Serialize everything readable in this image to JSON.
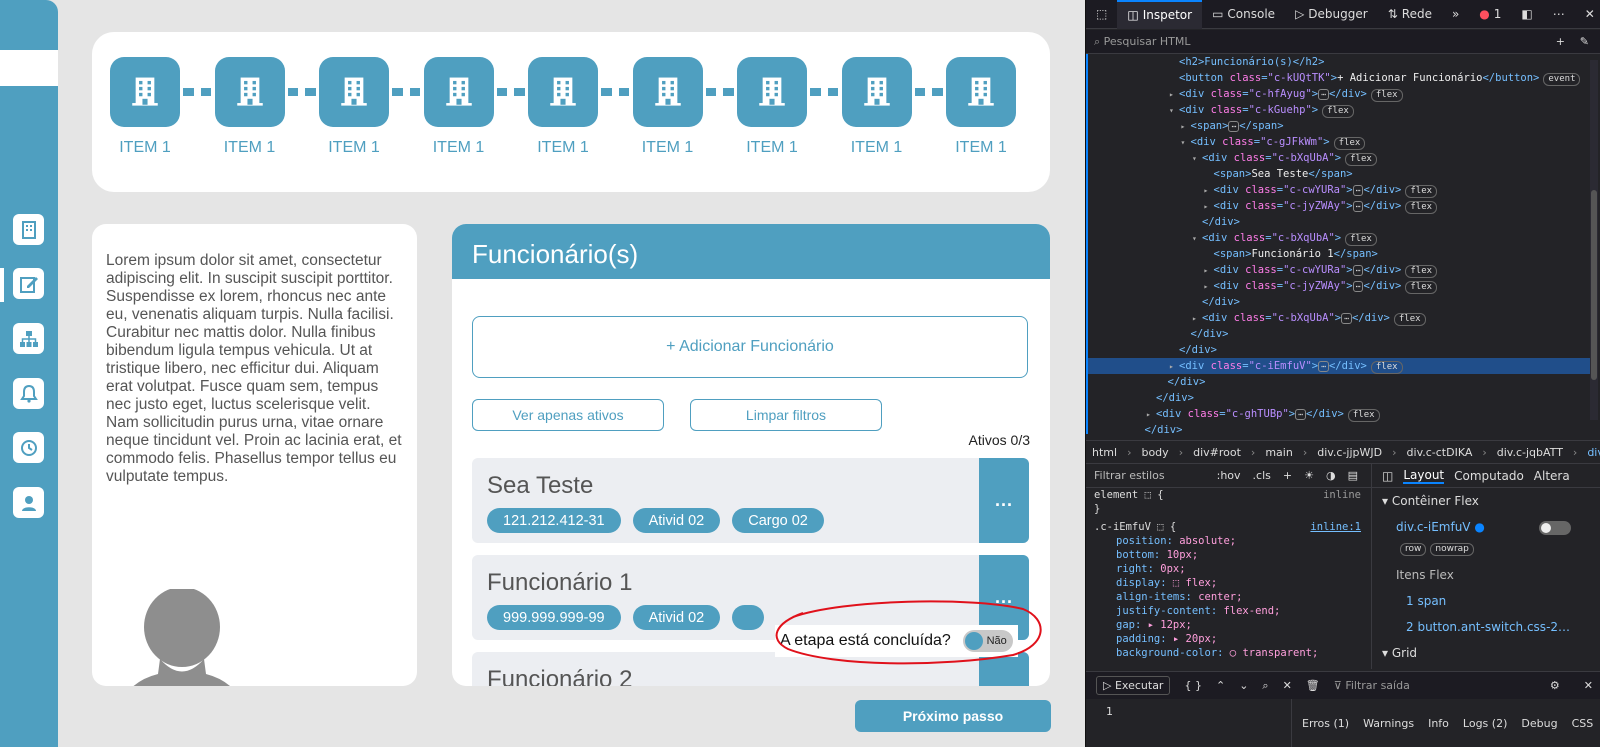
{
  "app": {
    "step_label": "ITEM 1",
    "steps_count_label": [
      "ITEM 1",
      "ITEM 1",
      "ITEM 1",
      "ITEM 1",
      "ITEM 1",
      "ITEM 1",
      "ITEM 1",
      "ITEM 1",
      "ITEM 1"
    ],
    "lorem": "Lorem ipsum dolor sit amet, consectetur adipiscing elit. In suscipit suscipit porttitor. Suspendisse ex lorem, rhoncus nec ante eu, venenatis aliquam turpis. Nulla facilisi. Curabitur nec mattis dolor. Nulla finibus bibendum ligula tempus vehicula. Ut at tristique libero, nec efficitur dui. Aliquam erat volutpat. Fusce quam sem, tempus nec justo eget, luctus scelerisque velit. Nam sollicitudin purus urna, vitae ornare neque tincidunt vel. Proin ac lacinia erat, et commodo felis. Phasellus tempor tellus eu vulputate tempus.",
    "employees": {
      "title": "Funcionário(s)",
      "add_button": "+ Adicionar Funcionário",
      "filter_active": "Ver apenas ativos",
      "filter_clear": "Limpar filtros",
      "active_count": "Ativos 0/3",
      "cards": [
        {
          "name": "Sea Teste",
          "chips": [
            "121.212.412-31",
            "Ativid 02",
            "Cargo 02"
          ]
        },
        {
          "name": "Funcionário 1",
          "chips": [
            "999.999.999-99",
            "Ativid 02",
            ""
          ]
        },
        {
          "name": "Funcionário 2",
          "chips": []
        }
      ],
      "more_label": "..."
    },
    "step_done_question": "A etapa está concluída?",
    "switch_state": "Não",
    "next_button": "Próximo passo"
  },
  "devtools": {
    "tabs": [
      "Inspetor",
      "Console",
      "Debugger",
      "Rede"
    ],
    "error_count": "1",
    "search_placeholder": "Pesquisar HTML",
    "tree": [
      {
        "indent": 6,
        "tri": "",
        "html": "<h2>Funcionário(s)</h2>",
        "type": "raw"
      },
      {
        "indent": 6,
        "tri": "",
        "tag": "button",
        "cls": "c-kUQtTK",
        "text": "+ Adicionar Funcionário",
        "close": "</button>",
        "badge": "event"
      },
      {
        "indent": 6,
        "tri": "▸",
        "tag": "div",
        "cls": "c-hfAyug",
        "text": "",
        "ell": true,
        "close": "</div>",
        "badge": "flex"
      },
      {
        "indent": 6,
        "tri": "▾",
        "tag": "div",
        "cls": "c-kGuehp",
        "text": "",
        "close": "",
        "badge": "flex"
      },
      {
        "indent": 7,
        "tri": "▸",
        "tag": "span",
        "cls": "",
        "ell": true,
        "close": "</span>",
        "badge": ""
      },
      {
        "indent": 7,
        "tri": "▾",
        "tag": "div",
        "cls": "c-gJFkWm",
        "close": "",
        "badge": "flex"
      },
      {
        "indent": 8,
        "tri": "▾",
        "tag": "div",
        "cls": "c-bXqUbA",
        "close": "",
        "badge": "flex"
      },
      {
        "indent": 9,
        "tri": "",
        "tag": "span",
        "cls": "",
        "text": "Sea Teste",
        "close": "</span>",
        "badge": ""
      },
      {
        "indent": 9,
        "tri": "▸",
        "tag": "div",
        "cls": "c-cwYURa",
        "ell": true,
        "close": "</div>",
        "badge": "flex"
      },
      {
        "indent": 9,
        "tri": "▸",
        "tag": "div",
        "cls": "c-jyZWAy",
        "ell": true,
        "close": "</div>",
        "badge": "flex"
      },
      {
        "indent": 8,
        "tri": "",
        "close_only": "</div>"
      },
      {
        "indent": 8,
        "tri": "▾",
        "tag": "div",
        "cls": "c-bXqUbA",
        "close": "",
        "badge": "flex"
      },
      {
        "indent": 9,
        "tri": "",
        "tag": "span",
        "cls": "",
        "text": "Funcionário 1",
        "close": "</span>",
        "badge": ""
      },
      {
        "indent": 9,
        "tri": "▸",
        "tag": "div",
        "cls": "c-cwYURa",
        "ell": true,
        "close": "</div>",
        "badge": "flex"
      },
      {
        "indent": 9,
        "tri": "▸",
        "tag": "div",
        "cls": "c-jyZWAy",
        "ell": true,
        "close": "</div>",
        "badge": "flex"
      },
      {
        "indent": 8,
        "tri": "",
        "close_only": "</div>"
      },
      {
        "indent": 8,
        "tri": "▸",
        "tag": "div",
        "cls": "c-bXqUbA",
        "ell": true,
        "close": "</div>",
        "badge": "flex"
      },
      {
        "indent": 7,
        "tri": "",
        "close_only": "</div>"
      },
      {
        "indent": 6,
        "tri": "",
        "close_only": "</div>"
      },
      {
        "indent": 6,
        "tri": "▸",
        "tag": "div",
        "cls": "c-iEmfuV",
        "ell": true,
        "close": "</div>",
        "badge": "flex",
        "selected": true
      },
      {
        "indent": 5,
        "tri": "",
        "close_only": "</div>"
      },
      {
        "indent": 4,
        "tri": "",
        "close_only": "</div>"
      },
      {
        "indent": 4,
        "tri": "▸",
        "tag": "div",
        "cls": "c-ghTUBp",
        "ell": true,
        "close": "</div>",
        "badge": "flex"
      },
      {
        "indent": 3,
        "tri": "",
        "close_only": "</div>"
      },
      {
        "indent": 3,
        "tri": "",
        "close_only": "</main>"
      }
    ],
    "breadcrumbs": [
      "html",
      "body",
      "div#root",
      "main",
      "div.c-jjpWJD",
      "div.c-ctDIKA",
      "div.c-jqbATT",
      "div.c-iEmfuV"
    ],
    "filter_styles": "Filtrar estilos",
    "hov": ":hov",
    "cls": ".cls",
    "rules": {
      "element_line": "element ⬚ {",
      "inline": "inline",
      "close": "}",
      "selector": ".c-iEmfuV ⬚ {",
      "source": "inline:1",
      "decls": [
        [
          "position",
          "absolute"
        ],
        [
          "bottom",
          "10px"
        ],
        [
          "right",
          "0px"
        ],
        [
          "display",
          "⬚ flex"
        ],
        [
          "align-items",
          "center"
        ],
        [
          "justify-content",
          "flex-end"
        ],
        [
          "gap",
          "▸ 12px"
        ],
        [
          "padding",
          "▸ 20px"
        ],
        [
          "background-color",
          "◯ transparent"
        ]
      ]
    },
    "right_tabs": [
      "Layout",
      "Computado",
      "Altera"
    ],
    "flex_container": "Contêiner Flex",
    "flex_el": "div.c-iEmfuV",
    "flex_tags": [
      "row",
      "nowrap"
    ],
    "flex_items_title": "Itens Flex",
    "flex_items": [
      "1  span",
      "2  button.ant-switch.css-2…"
    ],
    "grid_title": "Grid",
    "console": {
      "exec": "Executar",
      "braces": "{ }",
      "filter": "Filtrar saída",
      "levels": [
        "Erros (1)",
        "Warnings",
        "Info",
        "Logs (2)",
        "Debug",
        "CSS"
      ],
      "line": "1"
    }
  }
}
